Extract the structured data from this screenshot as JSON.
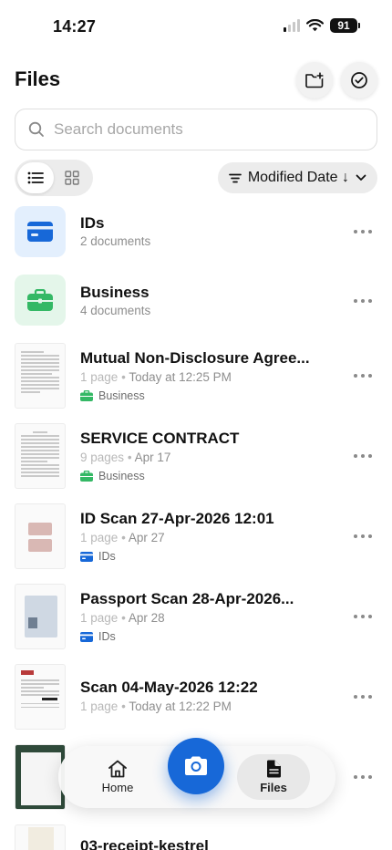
{
  "status_bar": {
    "time": "14:27",
    "battery": "91"
  },
  "header": {
    "title": "Files"
  },
  "search": {
    "placeholder": "Search documents"
  },
  "sort": {
    "label": "Modified Date",
    "direction": "↓"
  },
  "items": [
    {
      "kind": "folder",
      "title": "IDs",
      "subtitle": "2 documents",
      "color": "#1768d8",
      "bg": "#e3effd"
    },
    {
      "kind": "folder",
      "title": "Business",
      "subtitle": "4 documents",
      "color": "#34b865",
      "bg": "#e4f6ea"
    },
    {
      "kind": "doc",
      "title": "Mutual Non-Disclosure Agree...",
      "pages": "1 page",
      "date": "Today at 12:25 PM",
      "folder": "Business"
    },
    {
      "kind": "doc",
      "title": "SERVICE CONTRACT",
      "pages": "9 pages",
      "date": "Apr 17",
      "folder": "Business"
    },
    {
      "kind": "doc",
      "title": "ID Scan 27-Apr-2026 12:01",
      "pages": "1 page",
      "date": "Apr 27",
      "folder": "IDs"
    },
    {
      "kind": "doc",
      "title": "Passport Scan 28-Apr-2026...",
      "pages": "1 page",
      "date": "Apr 28",
      "folder": "IDs"
    },
    {
      "kind": "doc",
      "title": "Scan 04-May-2026 12:22",
      "pages": "1 page",
      "date": "Today at 12:22 PM",
      "folder": ""
    },
    {
      "kind": "doc",
      "title": "03-receipt-kestrel",
      "pages": "",
      "date": "",
      "folder": ""
    }
  ],
  "tabbar": {
    "home": "Home",
    "files": "Files"
  },
  "colors": {
    "accent": "#1768d8",
    "business": "#34b865",
    "ids": "#1768d8"
  }
}
